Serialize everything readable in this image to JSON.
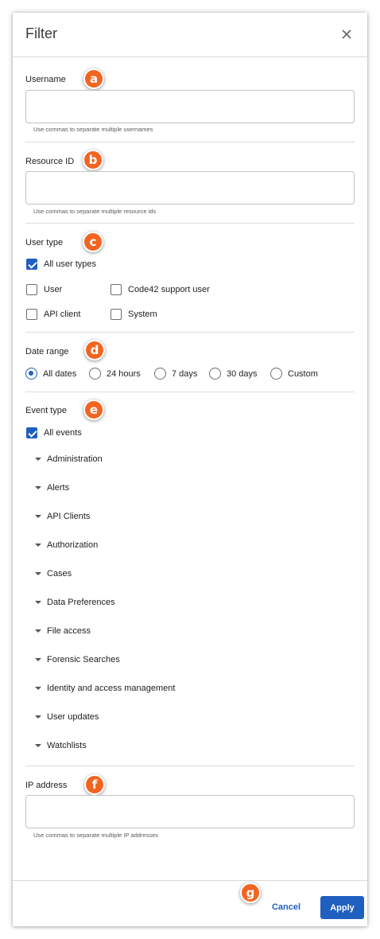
{
  "dialog": {
    "title": "Filter"
  },
  "username": {
    "label": "Username",
    "value": "",
    "placeholder": "",
    "help": "Use commas to separate multiple usernames"
  },
  "resource_id": {
    "label": "Resource ID",
    "value": "",
    "placeholder": "",
    "help": "Use commas to separate multiple resource ids"
  },
  "user_type": {
    "label": "User type",
    "options": [
      {
        "label": "All user types",
        "checked": true
      },
      {
        "label": "User",
        "checked": false
      },
      {
        "label": "Code42 support user",
        "checked": false
      },
      {
        "label": "API client",
        "checked": false
      },
      {
        "label": "System",
        "checked": false
      }
    ]
  },
  "date_range": {
    "label": "Date range",
    "selected": "All dates",
    "options": [
      "All dates",
      "24 hours",
      "7 days",
      "30 days",
      "Custom"
    ]
  },
  "event_type": {
    "label": "Event type",
    "all": {
      "label": "All events",
      "checked": true
    },
    "groups": [
      "Administration",
      "Alerts",
      "API Clients",
      "Authorization",
      "Cases",
      "Data Preferences",
      "File access",
      "Forensic Searches",
      "Identity and access management",
      "User updates",
      "Watchlists"
    ]
  },
  "ip_address": {
    "label": "IP address",
    "value": "",
    "placeholder": "",
    "help": "Use commas to separate multiple IP addresses"
  },
  "footer": {
    "cancel_label": "Cancel",
    "apply_label": "Apply"
  },
  "badges": [
    "a",
    "b",
    "c",
    "d",
    "e",
    "f",
    "g"
  ],
  "colors": {
    "accent": "#1f5fbf",
    "badge": "#f26521",
    "divider": "#dcdcdc"
  }
}
